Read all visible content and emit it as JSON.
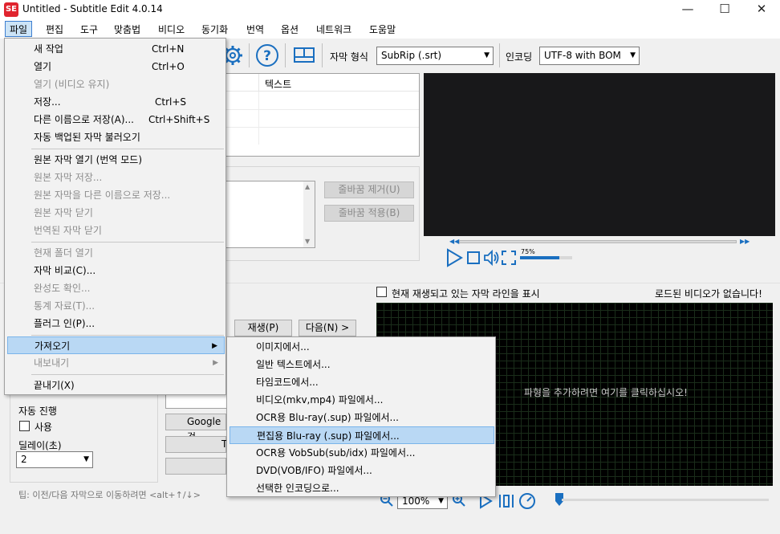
{
  "window": {
    "title": "Untitled - Subtitle Edit 4.0.14",
    "minimize": "—",
    "maximize": "☐",
    "close": "✕"
  },
  "menubar": [
    "파일",
    "편집",
    "도구",
    "맞춤법",
    "비디오",
    "동기화",
    "번역",
    "옵션",
    "네트워크",
    "도움말"
  ],
  "toolbar": {
    "format_label": "자막 형식",
    "format_value": "SubRip (.srt)",
    "encoding_label": "인코딩",
    "encoding_value": "UTF-8 with BOM"
  },
  "grid": {
    "col_text": "텍스트"
  },
  "editor": {
    "remove_linebreaks": "줄바꿈 제거(U)",
    "apply_linebreaks": "줄바꿈 적용(B)"
  },
  "video": {
    "volume_pct": "75%",
    "volume_level": 0.75,
    "show_current_label": "현재 재생되고 있는 자막 라인을 표시",
    "no_video": "로드된 비디오가 없습니다!",
    "waveform_hint": "파형을 추가하려면 여기를 클릭하십시오!",
    "zoom": "100%"
  },
  "bottom_left": {
    "play": "재생(P)",
    "next": "다음(N) >",
    "auto_label": "자동 진행",
    "use_label": "사용",
    "delay_label": "딜레이(초)",
    "delay_value": "2",
    "google_btn": "Google 검",
    "t_btn": "T",
    "tip": "팁: 이전/다음 자막으로 이동하려면 <alt+↑/↓>"
  },
  "file_menu": {
    "new": "새 작업",
    "new_sc": "Ctrl+N",
    "open": "열기",
    "open_sc": "Ctrl+O",
    "open_keep_video": "열기 (비디오 유지)",
    "save": "저장...",
    "save_sc": "Ctrl+S",
    "save_as": "다른 이름으로 저장(A)...",
    "save_as_sc": "Ctrl+Shift+S",
    "restore_autobackup": "자동 백업된 자막 불러오기",
    "open_original": "원본 자막 열기 (번역 모드)",
    "save_original": "원본 자막 저장...",
    "save_original_as": "원본 자막을 다른 이름으로 저장...",
    "close_original": "원본 자막 닫기",
    "close_translated": "번역된 자막 닫기",
    "open_folder": "현재 폴더 열기",
    "compare": "자막 비교(C)...",
    "completeness": "완성도 확인...",
    "statistics": "통계 자료(T)...",
    "plugins": "플러그 인(P)...",
    "import": "가져오기",
    "export": "내보내기",
    "exit": "끝내기(X)"
  },
  "import_submenu": [
    "이미지에서...",
    "일반 텍스트에서...",
    "타임코드에서...",
    "비디오(mkv,mp4) 파일에서...",
    "OCR용 Blu-ray(.sup) 파일에서...",
    "편집용 Blu-ray (.sup) 파일에서...",
    "OCR용 VobSub(sub/idx) 파일에서...",
    "DVD(VOB/IFO) 파일에서...",
    "선택한 인코딩으로..."
  ]
}
